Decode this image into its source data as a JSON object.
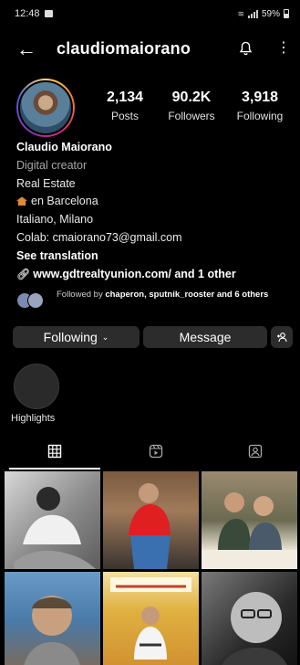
{
  "status_bar": {
    "time": "12:48",
    "battery": "59%"
  },
  "header": {
    "username": "claudiomaiorano"
  },
  "profile": {
    "stats": [
      {
        "value": "2,134",
        "label": "Posts"
      },
      {
        "value": "90.2K",
        "label": "Followers"
      },
      {
        "value": "3,918",
        "label": "Following"
      }
    ],
    "bio": {
      "name": "Claudio Maiorano",
      "category": "Digital creator",
      "line1": "Real Estate",
      "line2": "en Barcelona",
      "line3": "Italiano, Milano",
      "line4": "Colab: cmaiorano73@gmail.com",
      "see_translation": "See translation",
      "link": "www.gdtrealtyunion.com/ and 1 other"
    },
    "followed_by": {
      "prefix": "Followed by",
      "names": "chaperon, sputnik_rooster",
      "suffix": "and 6 others"
    }
  },
  "actions": {
    "following": "Following",
    "message": "Message"
  },
  "highlights": {
    "label": "Highlights"
  },
  "tabs": [
    "grid-icon",
    "reels-icon",
    "tagged-icon"
  ],
  "colors": {
    "background": "#000000",
    "button": "#2c2c2c",
    "text": "#ffffff"
  }
}
